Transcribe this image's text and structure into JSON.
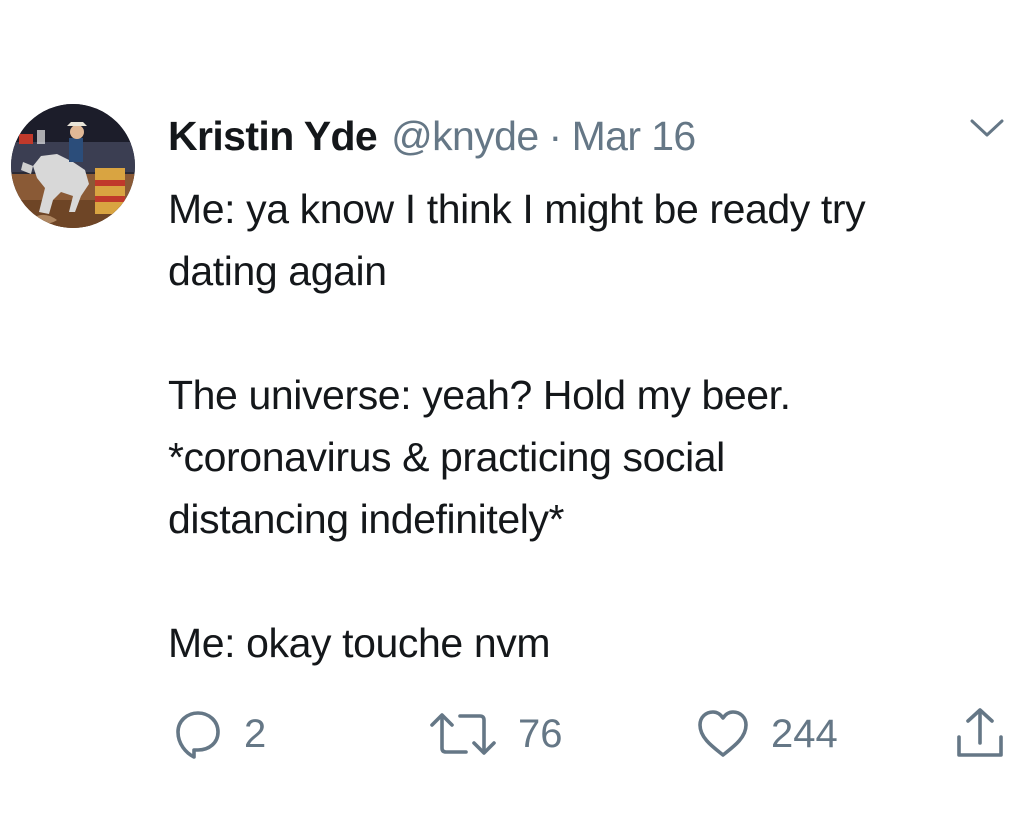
{
  "tweet": {
    "author": {
      "display_name": "Kristin Yde",
      "handle": "@knyde",
      "avatar_icon": "rodeo-barrel-racer-photo"
    },
    "separator": "·",
    "date": "Mar 16",
    "menu_icon": "chevron-down-icon",
    "text_lines": [
      "Me: ya know I think I might be ready try",
      "dating again",
      "",
      "The universe: yeah? Hold my beer.",
      "*coronavirus & practicing social",
      "distancing indefinitely*",
      "",
      "Me: okay touche nvm"
    ],
    "actions": {
      "reply": {
        "icon": "reply-bubble-icon",
        "count": "2"
      },
      "retweet": {
        "icon": "retweet-icon",
        "count": "76"
      },
      "like": {
        "icon": "heart-icon",
        "count": "244"
      },
      "share": {
        "icon": "share-icon"
      }
    },
    "colors": {
      "text": "#14171a",
      "secondary": "#657786",
      "background": "#ffffff"
    }
  }
}
